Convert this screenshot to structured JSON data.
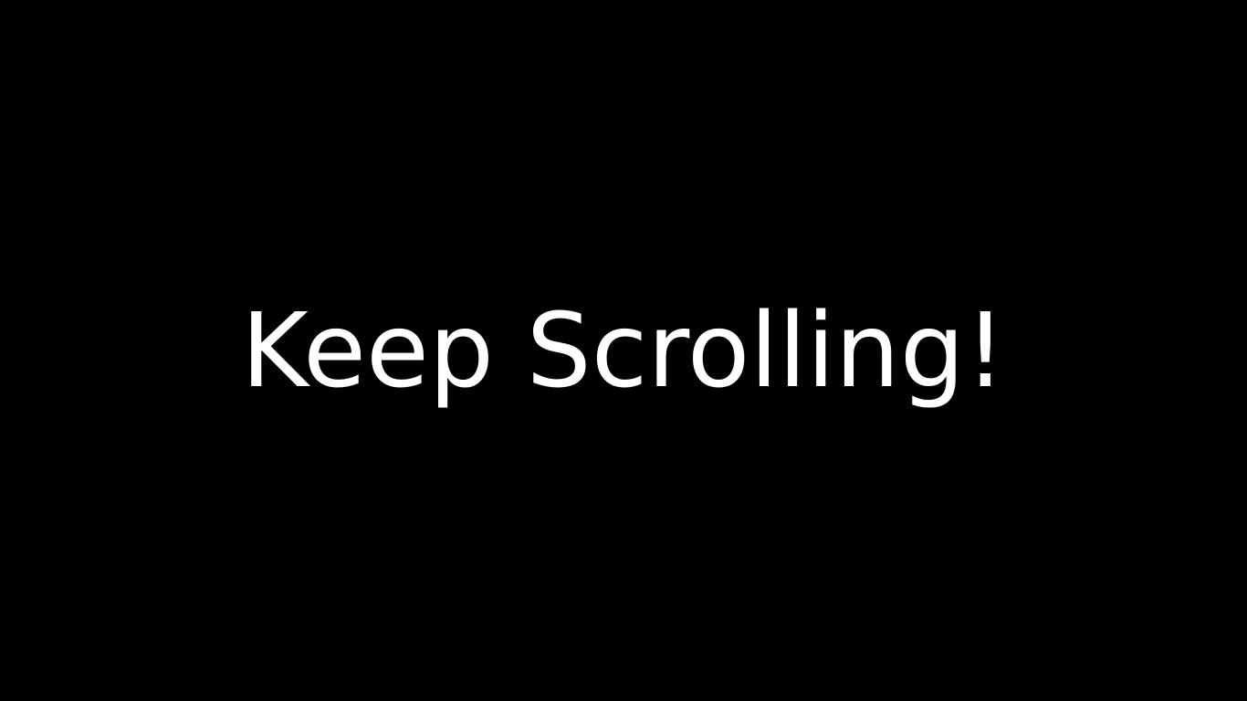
{
  "screen": {
    "background_color": "#000000",
    "text_color": "#ffffff",
    "headline": "Keep Scrolling!"
  }
}
